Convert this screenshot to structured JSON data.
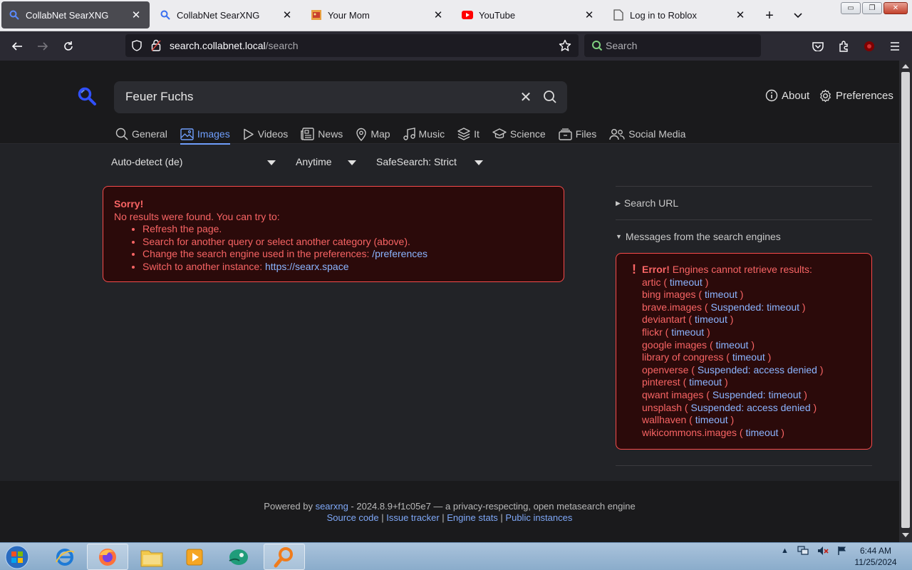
{
  "browser": {
    "tabs": [
      {
        "label": "CollabNet SearXNG",
        "favicon": "magnifier-icon",
        "active": true
      },
      {
        "label": "CollabNet SearXNG",
        "favicon": "magnifier-icon",
        "active": false
      },
      {
        "label": "Your Mom",
        "favicon": "image-icon",
        "active": false
      },
      {
        "label": "YouTube",
        "favicon": "youtube-icon",
        "active": false
      },
      {
        "label": "Log in to Roblox",
        "favicon": "document-icon",
        "active": false
      }
    ],
    "url": {
      "domain": "search.collabnet.local",
      "path": "/search"
    },
    "search_placeholder": "Search"
  },
  "search": {
    "query": "Feuer Fuchs",
    "about_label": "About",
    "preferences_label": "Preferences",
    "categories": [
      {
        "label": "General",
        "icon": "search-icon"
      },
      {
        "label": "Images",
        "icon": "image-icon",
        "active": true
      },
      {
        "label": "Videos",
        "icon": "play-icon"
      },
      {
        "label": "News",
        "icon": "newspaper-icon"
      },
      {
        "label": "Map",
        "icon": "map-pin-icon"
      },
      {
        "label": "Music",
        "icon": "music-icon"
      },
      {
        "label": "It",
        "icon": "layers-icon"
      },
      {
        "label": "Science",
        "icon": "school-icon"
      },
      {
        "label": "Files",
        "icon": "files-icon"
      },
      {
        "label": "Social Media",
        "icon": "people-icon"
      }
    ],
    "filters": {
      "language": "Auto-detect (de)",
      "time": "Anytime",
      "safesearch": "SafeSearch: Strict"
    }
  },
  "error": {
    "title": "Sorry!",
    "message": "No results were found. You can try to:",
    "items": [
      "Refresh the page.",
      "Search for another query or select another category (above).",
      "Change the search engine used in the preferences: ",
      "Switch to another instance: "
    ],
    "preferences_link": "/preferences",
    "instance_link": "https://searx.space"
  },
  "sidebar": {
    "search_url_label": "Search URL",
    "messages_label": "Messages from the search engines",
    "error_label": "Error!",
    "error_text": "Engines cannot retrieve results:",
    "engines": [
      {
        "name": "artic",
        "reason": "timeout"
      },
      {
        "name": "bing images",
        "reason": "timeout"
      },
      {
        "name": "brave.images",
        "reason": "Suspended: timeout"
      },
      {
        "name": "deviantart",
        "reason": "timeout"
      },
      {
        "name": "flickr",
        "reason": "timeout"
      },
      {
        "name": "google images",
        "reason": "timeout"
      },
      {
        "name": "library of congress",
        "reason": "timeout"
      },
      {
        "name": "openverse",
        "reason": "Suspended: access denied"
      },
      {
        "name": "pinterest",
        "reason": "timeout"
      },
      {
        "name": "qwant images",
        "reason": "Suspended: timeout"
      },
      {
        "name": "unsplash",
        "reason": "Suspended: access denied"
      },
      {
        "name": "wallhaven",
        "reason": "timeout"
      },
      {
        "name": "wikicommons.images",
        "reason": "timeout"
      }
    ]
  },
  "footer": {
    "powered_prefix": "Powered by ",
    "searxng_link": "searxng",
    "powered_suffix": " - 2024.8.9+f1c05e7 — a privacy-respecting, open metasearch engine",
    "links": [
      "Source code",
      "Issue tracker",
      "Engine stats",
      "Public instances"
    ]
  },
  "taskbar": {
    "time": "6:44 AM",
    "date": "11/25/2024"
  },
  "colors": {
    "accent": "#6f9efc",
    "error_border": "#f84b4b",
    "error_text": "#f86464",
    "link": "#8bb4ff"
  }
}
